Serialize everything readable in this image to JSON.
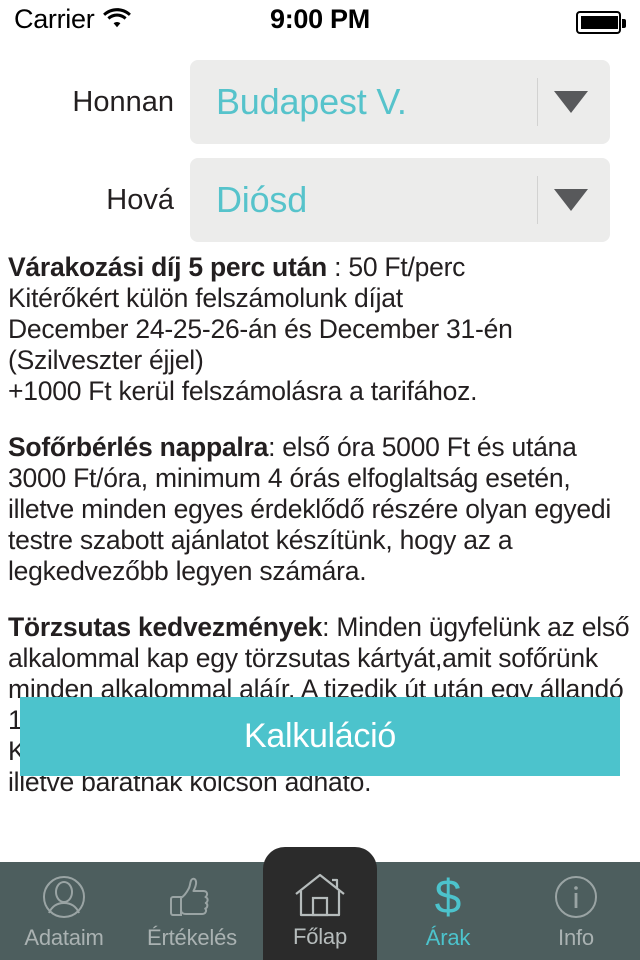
{
  "statusbar": {
    "carrier": "Carrier",
    "wifi_icon": "wifi-icon",
    "time": "9:00 PM",
    "battery_icon": "battery-icon"
  },
  "form": {
    "from": {
      "label": "Honnan",
      "value": "Budapest V.",
      "arrow_icon": "chevron-down-icon"
    },
    "to": {
      "label": "Hová",
      "value": "Diósd",
      "arrow_icon": "chevron-down-icon"
    }
  },
  "info": {
    "para1": {
      "heading": "Várakozási díj 5 perc után",
      "body": " : 50 Ft/perc\nKitérőkért külön felszámolunk díjat\nDecember 24-25-26-án és December 31-én (Szilveszter éjjel)\n+1000 Ft kerül felszámolásra a tarifához."
    },
    "para2": {
      "heading": "Sofőrbérlés nappalra",
      "body": ": első óra 5000 Ft és utána 3000 Ft/óra, minimum 4 órás elfoglaltság esetén, illetve minden egyes érdeklődő részére olyan egyedi testre szabott ajánlatot készítünk, hogy az a legkedvezőbb legyen számára."
    },
    "para3": {
      "heading": "Törzsutas kedvezmények",
      "body": ": Minden ügyfelünk az első alkalommal kap egy törzsutas kártyát,amit sofőrünk minden alkalommal aláír. A tizedik út után egy állandó 10% os kedvezményre jogosító VIP kártyát adunk át. Kártya nem névre szól, így bármely családtagnak illetve barátnak kölcsön adható."
    }
  },
  "cta": {
    "label": "Kalkuláció"
  },
  "tabbar": {
    "items": [
      {
        "label": "Adataim",
        "icon": "person-circle-icon",
        "active": false
      },
      {
        "label": "Értékelés",
        "icon": "thumbs-up-icon",
        "active": false
      },
      {
        "label": "Főlap",
        "icon": "home-icon",
        "active": false
      },
      {
        "label": "Árak",
        "icon": "dollar-icon",
        "active": true
      },
      {
        "label": "Info",
        "icon": "info-circle-icon",
        "active": false
      }
    ]
  },
  "colors": {
    "accent_teal": "#4cc3cc",
    "select_bg": "#ececeb",
    "tabbar_bg": "#4d5e5e",
    "center_tab_bg": "#2b2b2b",
    "text_dark": "#231f20",
    "tab_label": "#aab2b2"
  }
}
